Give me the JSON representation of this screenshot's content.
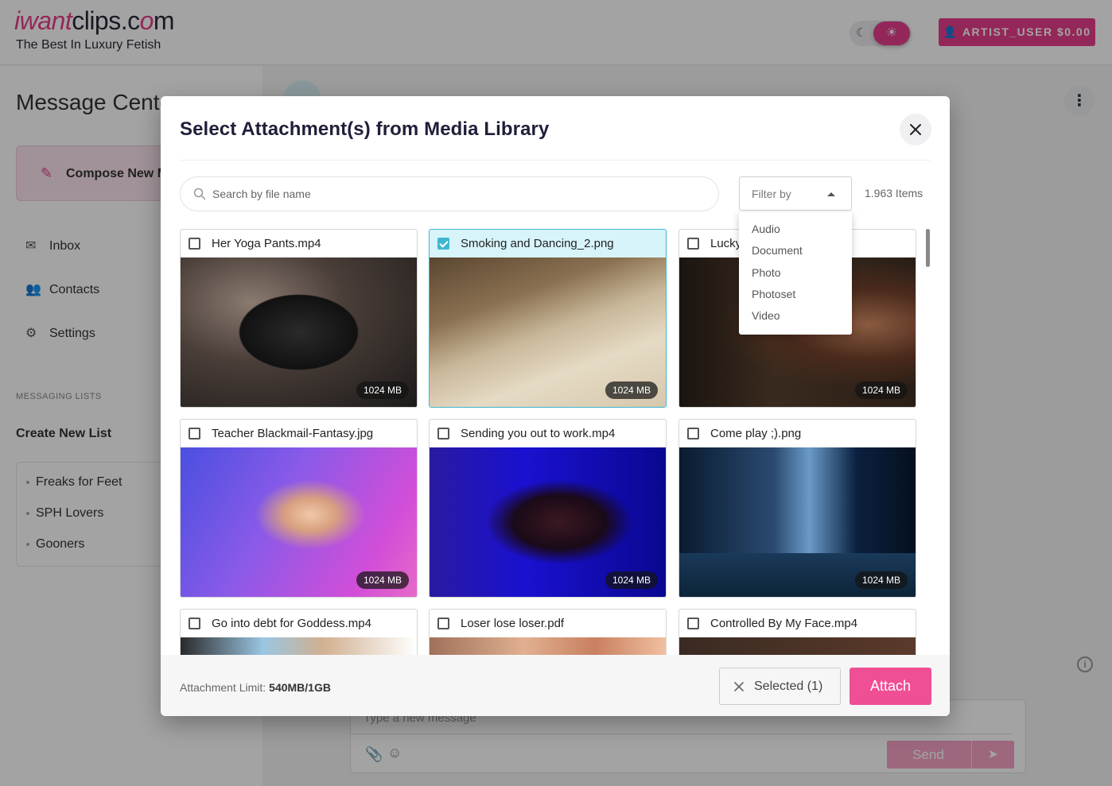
{
  "header": {
    "logo_prefix": "iwant",
    "logo_middle": "clips.c",
    "logo_o": "o",
    "logo_suffix": "m",
    "tagline": "The Best In Luxury Fetish",
    "user_button": "ARTIST_USER $0.00"
  },
  "sidebar": {
    "title": "Message Center",
    "compose_label": "Compose New Message",
    "nav": [
      {
        "label": "Inbox",
        "icon": "mail-icon"
      },
      {
        "label": "Contacts",
        "icon": "people-icon"
      },
      {
        "label": "Settings",
        "icon": "gear-icon"
      }
    ],
    "messaging_lists_title": "MESSAGING LISTS",
    "create_list_label": "Create New List",
    "lists": [
      "Freaks for Feet",
      "SPH Lovers",
      "Gooners"
    ]
  },
  "composer": {
    "placeholder": "Type a new message",
    "send_label": "Send"
  },
  "modal": {
    "title": "Select Attachment(s) from Media Library",
    "search_placeholder": "Search by file name",
    "filter_label": "Filter by",
    "item_count": "1.963 Items",
    "filter_options": [
      "Audio",
      "Document",
      "Photo",
      "Photoset",
      "Video"
    ],
    "items": [
      {
        "name": "Her Yoga Pants.mp4",
        "size": "1024 MB",
        "selected": false
      },
      {
        "name": "Smoking and Dancing_2.png",
        "size": "1024 MB",
        "selected": true
      },
      {
        "name": "Lucky",
        "size": "1024 MB",
        "selected": false
      },
      {
        "name": "Teacher Blackmail-Fantasy.jpg",
        "size": "1024 MB",
        "selected": false
      },
      {
        "name": "Sending you out to work.mp4",
        "size": "1024 MB",
        "selected": false
      },
      {
        "name": "Come play ;).png",
        "size": "1024 MB",
        "selected": false
      },
      {
        "name": "Go into debt for Goddess.mp4",
        "size": "",
        "selected": false
      },
      {
        "name": "Loser lose loser.pdf",
        "size": "",
        "selected": false
      },
      {
        "name": "Controlled By My Face.mp4",
        "size": "",
        "selected": false
      }
    ],
    "limit_label": "Attachment Limit:",
    "limit_value": "540MB/1GB",
    "selected_label": "Selected (1)",
    "attach_label": "Attach"
  },
  "colors": {
    "accent": "#e83e8c",
    "attach": "#ef4f94",
    "selection": "#3fb6d0"
  }
}
